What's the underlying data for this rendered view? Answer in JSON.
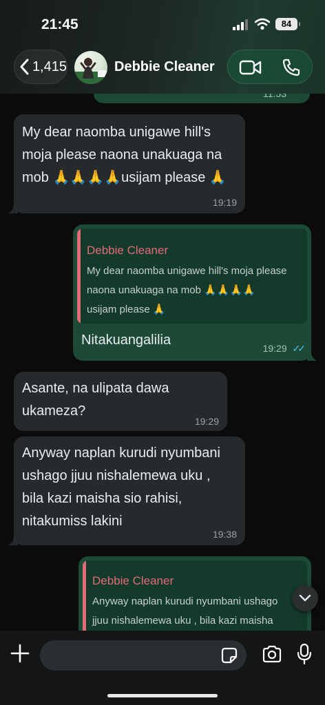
{
  "status_bar": {
    "time": "21:45",
    "battery": "84"
  },
  "header": {
    "back_count": "1,415",
    "contact_name": "Debbie Cleaner"
  },
  "messages": [
    {
      "direction": "out",
      "time_partial": "11:53"
    },
    {
      "direction": "in",
      "text_lines": [
        "My dear naomba unigawe hill's",
        "moja please naona unakuaga na",
        "mob 🙏🙏🙏🙏usijam please 🙏"
      ],
      "time": "19:19"
    },
    {
      "direction": "out",
      "quote": {
        "author": "Debbie Cleaner",
        "lines": [
          "My dear naomba unigawe hill's moja please",
          "naona unakuaga na mob 🙏🙏🙏🙏",
          "usijam please 🙏"
        ]
      },
      "text": "Nitakuangalilia",
      "time": "19:29",
      "status": "read"
    },
    {
      "direction": "in",
      "text_lines": [
        "Asante, na ulipata dawa",
        "ukameza?"
      ],
      "time": "19:29"
    },
    {
      "direction": "in",
      "text_lines": [
        "Anyway naplan kurudi nyumbani",
        "ushago jjuu nishalemewa uku ,",
        "bila kazi maisha sio rahisi,",
        "nitakumiss lakini"
      ],
      "time": "19:38"
    },
    {
      "direction": "out",
      "quote": {
        "author": "Debbie Cleaner",
        "lines": [
          "Anyway naplan kurudi nyumbani ushago",
          "jjuu nishalemewa uku , bila kazi maisha"
        ]
      }
    }
  ],
  "composer": {
    "placeholder": ""
  },
  "icons": {
    "back": "chevron-left-icon",
    "video": "video-camera-icon",
    "phone": "phone-icon",
    "scroll": "chevron-down-icon",
    "plus": "plus-icon",
    "sticker": "sticker-icon",
    "camera": "camera-icon",
    "mic": "microphone-icon"
  },
  "colors": {
    "incoming_bubble": "#262a2c",
    "outgoing_bubble": "#1c4a36",
    "quote_accent": "#e26b78",
    "read_ticks": "#53bdeb"
  }
}
